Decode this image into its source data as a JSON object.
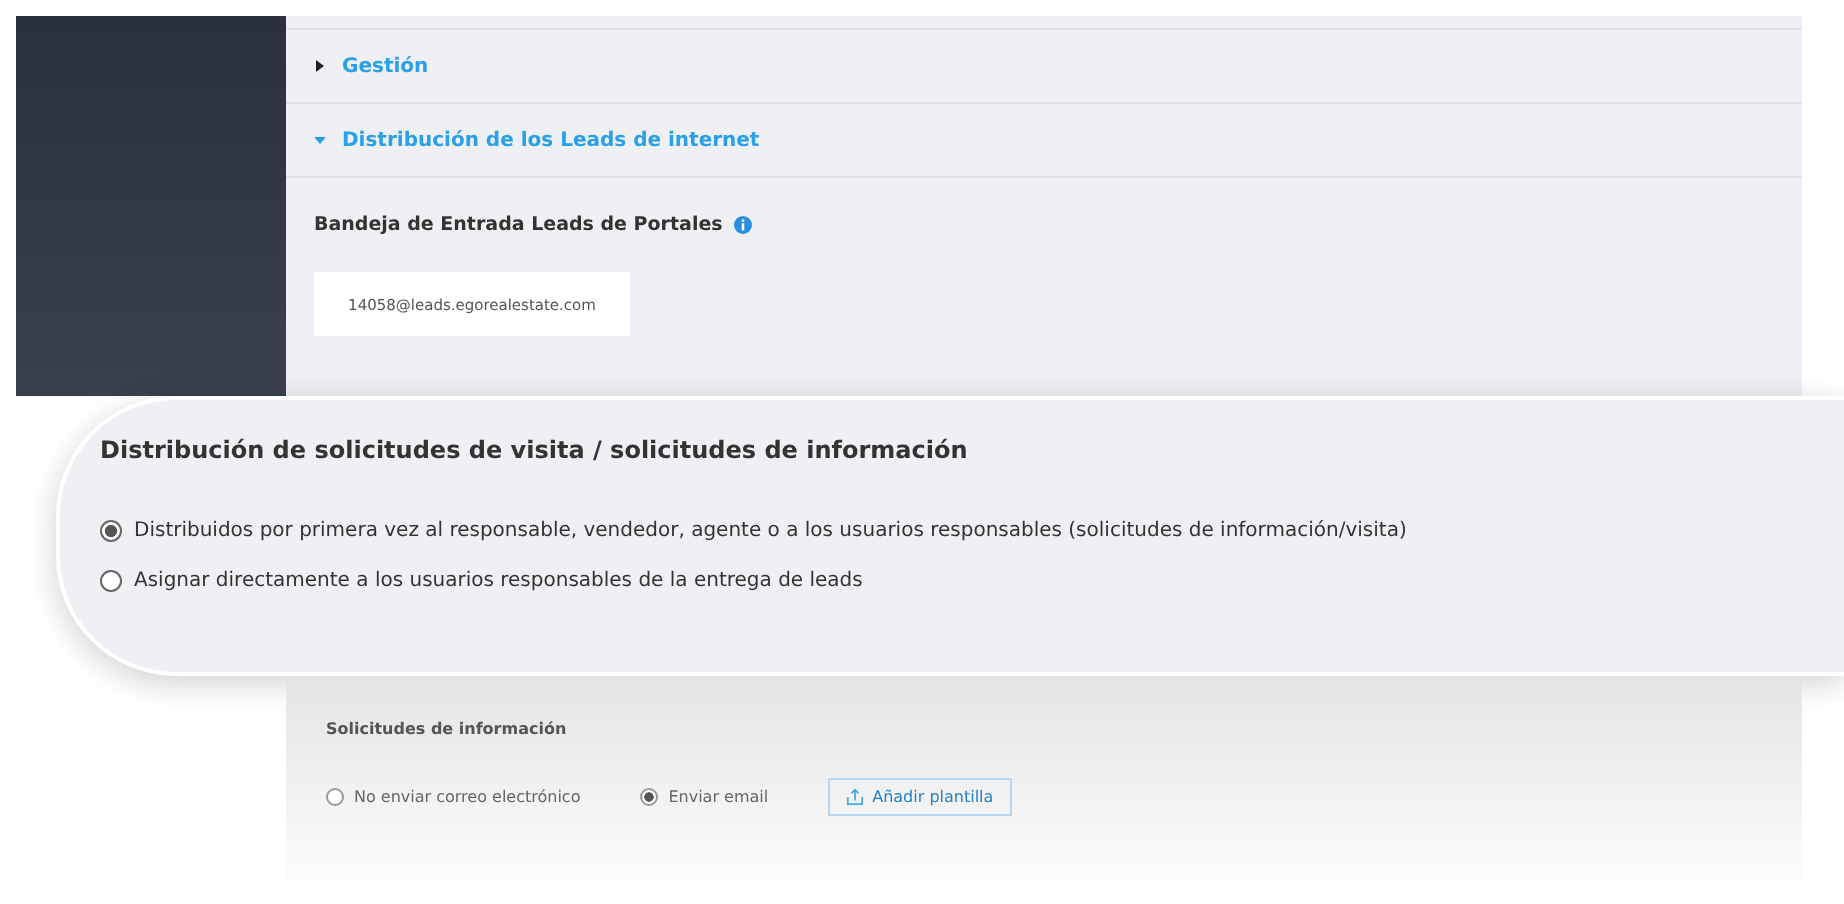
{
  "sections": [
    {
      "label": "Gestión",
      "expanded": false
    },
    {
      "label": "Distribución de los Leads de internet",
      "expanded": true
    }
  ],
  "inbox": {
    "label": "Bandeja de Entrada Leads de Portales",
    "value": "14058@leads.egorealestate.com"
  },
  "callout": {
    "title": "Distribución de solicitudes de visita / solicitudes de información",
    "options": [
      {
        "label": "Distribuidos por primera vez al responsable, vendedor, agente o a los usuarios responsables (solicitudes de información/visita)",
        "selected": true
      },
      {
        "label": "Asignar directamente a los usuarios responsables de la entrega de leads",
        "selected": false
      }
    ]
  },
  "requests": {
    "title": "Solicitudes de información",
    "options": [
      {
        "label": "No enviar correo electrónico",
        "selected": false
      },
      {
        "label": "Enviar email",
        "selected": true
      }
    ],
    "button": "Añadir plantilla"
  }
}
